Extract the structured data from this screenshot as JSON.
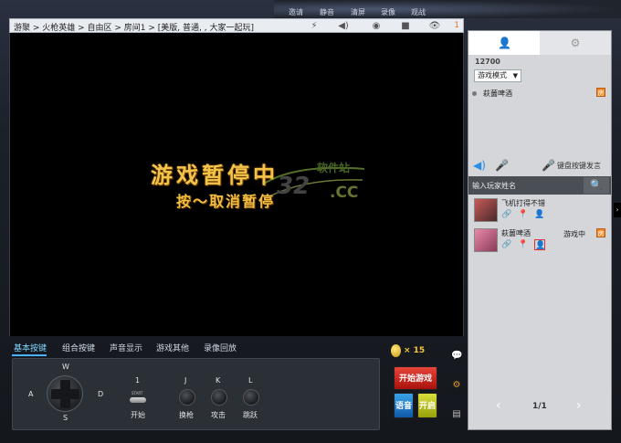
{
  "top_tools": [
    {
      "label": "邀请"
    },
    {
      "label": "静音"
    },
    {
      "label": "清屏"
    },
    {
      "label": "录像"
    },
    {
      "label": "观战"
    }
  ],
  "breadcrumb": "游聚 > 火枪英雄 > 自由区 > 房间1 > [美版, 普通, , 大家一起玩]",
  "viewer_count": "1",
  "game": {
    "paused_title": "游戏暂停中",
    "paused_hint": "按～取消暂停",
    "watermark_num": "32",
    "watermark_site": "软件站",
    "watermark_domain": ".CC"
  },
  "control_tabs": [
    {
      "label": "基本按键"
    },
    {
      "label": "组合按键"
    },
    {
      "label": "声音显示"
    },
    {
      "label": "游戏其他"
    },
    {
      "label": "录像回放"
    }
  ],
  "controls": {
    "dir_up": "W",
    "dir_left": "A",
    "dir_right": "D",
    "dir_down": "S",
    "start_key": "1",
    "start_mini": "START",
    "start_label": "开始",
    "btn1_key": "J",
    "btn1_label": "换枪",
    "btn2_key": "K",
    "btn2_label": "攻击",
    "btn3_key": "L",
    "btn3_label": "跳跃"
  },
  "coins": "× 15",
  "buttons": {
    "start_game": "开始游戏",
    "voice": "语音",
    "open": "开启"
  },
  "right_panel": {
    "room_id": "12700",
    "mode": "游戏模式",
    "member": "萩薗啤酒",
    "house_badge": "房",
    "voice_hint": "键盘按键发言",
    "search_placeholder": "输入玩家姓名",
    "players": [
      {
        "name": "飞机打得不错",
        "status": ""
      },
      {
        "name": "萩薗啤酒",
        "status": "游戏中"
      }
    ],
    "page": "1/1"
  },
  "colors": {
    "accent_blue": "#4ab0ff",
    "start_red": "#d0281e",
    "paused_gold": "#f4c44a"
  }
}
